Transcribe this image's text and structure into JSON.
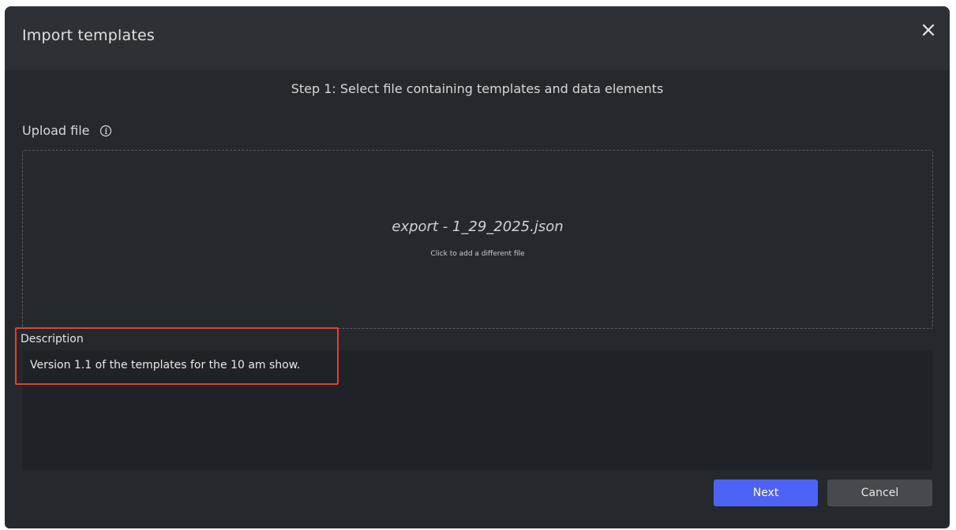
{
  "dialog": {
    "title": "Import templates",
    "close_icon": "close-icon"
  },
  "step": {
    "title": "Step 1: Select file containing templates and data elements"
  },
  "upload": {
    "label": "Upload file",
    "info_icon": "info-icon",
    "file_name": "export - 1_29_2025.json",
    "hint": "Click to add a different file"
  },
  "description": {
    "label": "Description",
    "value": "Version 1.1 of the templates for the 10 am show."
  },
  "buttons": {
    "next": "Next",
    "cancel": "Cancel"
  },
  "colors": {
    "dialog_bg": "#25292d",
    "header_bg": "#2d3135",
    "primary": "#4d63f5",
    "secondary": "#464a4f",
    "highlight": "#d9443a"
  }
}
